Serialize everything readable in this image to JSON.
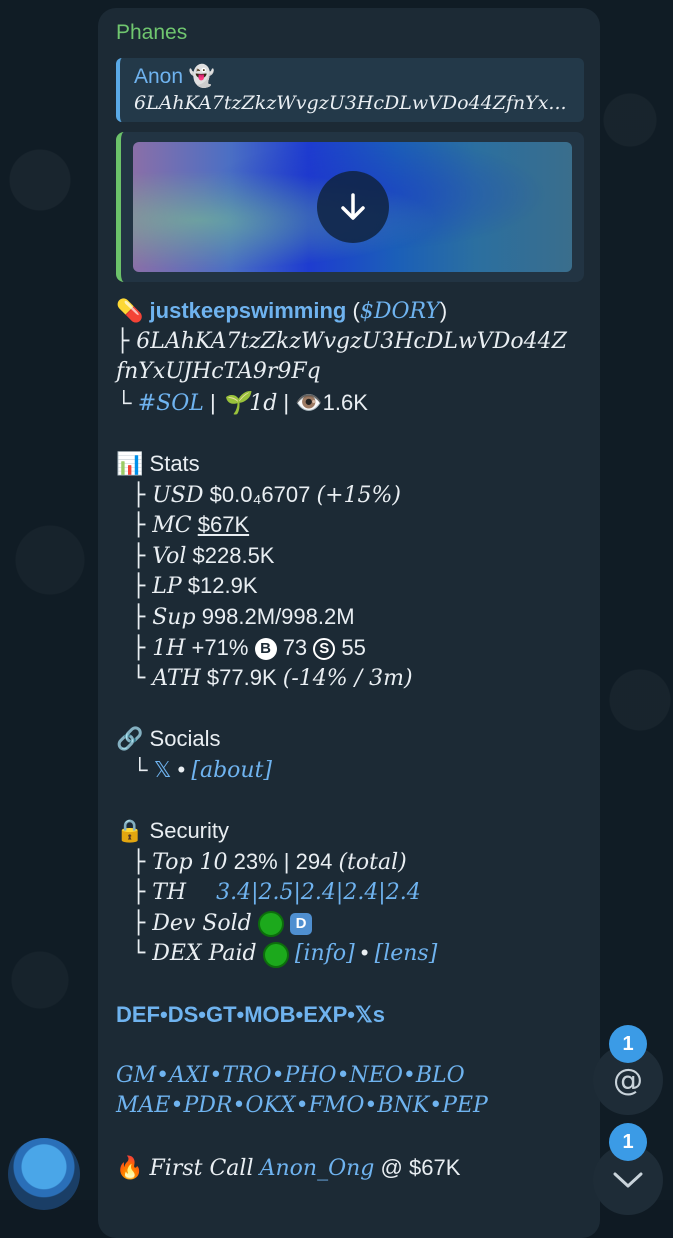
{
  "message": {
    "sender": "Phanes",
    "reply": {
      "name": "Anon 👻",
      "text": "6LAhKA7tzZkzWvgzU3HcDLwVDo44ZfnYx..."
    },
    "token": {
      "pill_icon": "💊",
      "name": "justkeepswimming",
      "ticker_open": "(",
      "ticker": "$DORY",
      "ticker_close": ")",
      "address_line1": "├ 6LAhKA7tzZkzWvgzU3HcDLwVDo44Z",
      "address_line2": "fnYxUJHcTA9r9Fq",
      "meta_prefix": "└ ",
      "chain": "#SOL",
      "sep": " | ",
      "age": "🌱1d",
      "views": "👁️1.6K"
    },
    "stats": {
      "heading_icon": "📊",
      "heading": "Stats",
      "usd_label": "├ USD",
      "usd_value": "$0.0₄6707",
      "usd_change": "(+15%)",
      "mc_label": "├ MC",
      "mc_value": "$67K",
      "vol_label": "├ Vol",
      "vol_value": "$228.5K",
      "lp_label": "├ LP",
      "lp_value": "$12.9K",
      "sup_label": "├ Sup",
      "sup_value": "998.2M/998.2M",
      "h1_label": "├ 1H",
      "h1_value": "+71%",
      "buys_icon": "B",
      "buys": "73",
      "sells_icon": "S",
      "sells": "55",
      "ath_label": "└ ATH",
      "ath_value": "$77.9K",
      "ath_note": "(-14% / 3m)"
    },
    "socials": {
      "heading_icon": "🔗",
      "heading": "Socials",
      "prefix": "└ ",
      "x": "𝕏",
      "dot": " • ",
      "about": "[about]"
    },
    "security": {
      "heading_icon": "🔒",
      "heading": "Security",
      "top10_label": "├ Top 10",
      "top10_value": "23% | 294",
      "top10_note": "(total)",
      "th_label": "├ TH",
      "th_value": "3.4|2.5|2.4|2.4|2.4",
      "dev_label": "├ Dev Sold",
      "dev_badge": "D",
      "dex_label": "└ DEX Paid",
      "dex_info": "[info]",
      "dex_dot": " • ",
      "dex_lens": "[lens]"
    },
    "links1": "DEF•DS•GT•MOB•EXP•𝕏s",
    "links2": "GM•AXI•TRO•PHO•NEO•BLO",
    "links3": "MAE•PDR•OKX•FMO•BNK•PEP",
    "first_call": {
      "icon": "🔥",
      "label": "First Call",
      "user": "Anon_Ong",
      "at": "@",
      "value": "$67K"
    }
  },
  "floating": {
    "mention_badge": "1",
    "mention_icon": "@",
    "scroll_badge": "1",
    "scroll_icon": "⌄"
  }
}
